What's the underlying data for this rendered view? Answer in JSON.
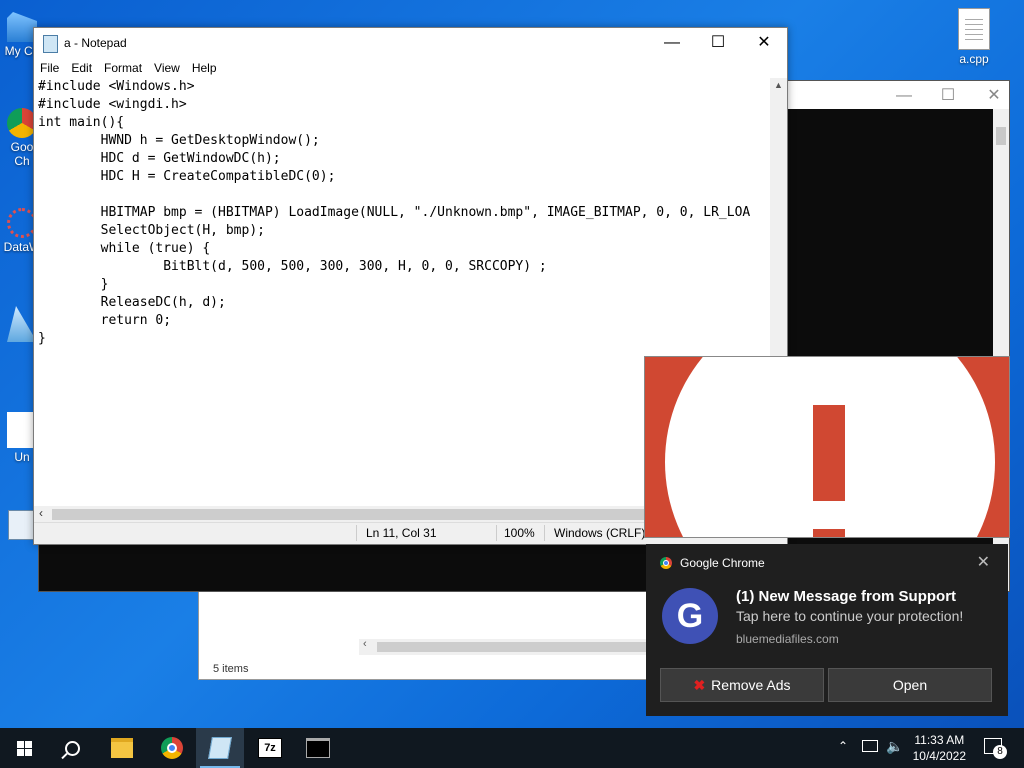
{
  "desktop": {
    "icons": [
      {
        "label": "My Co",
        "icon": "computer-icon"
      },
      {
        "label": "Goo Ch",
        "icon": "chrome-shortcut-icon"
      },
      {
        "label": "DataW",
        "icon": "dataw-shortcut-icon"
      },
      {
        "label": "",
        "icon": "recycle-icon"
      },
      {
        "label": "Un",
        "icon": "file-icon"
      }
    ],
    "file_icon": {
      "label": "a.cpp",
      "icon": "document-icon"
    }
  },
  "notepad": {
    "title": "a - Notepad",
    "menu": [
      "File",
      "Edit",
      "Format",
      "View",
      "Help"
    ],
    "code_lines": [
      "#include <Windows.h>",
      "#include <wingdi.h>",
      "int main(){",
      "        HWND h = GetDesktopWindow();",
      "        HDC d = GetWindowDC(h);",
      "        HDC H = CreateCompatibleDC(0);",
      "",
      "        HBITMAP bmp = (HBITMAP) LoadImage(NULL, \"./Unknown.bmp\", IMAGE_BITMAP, 0, 0, LR_LOA",
      "        SelectObject(H, bmp);",
      "        while (true) {",
      "                BitBlt(d, 500, 500, 300, 300, H, 0, 0, SRCCOPY) ;",
      "        }",
      "        ReleaseDC(h, d);",
      "        return 0;",
      "}"
    ],
    "status": {
      "position": "Ln 11, Col 31",
      "zoom": "100%",
      "line_endings": "Windows (CRLF)"
    }
  },
  "explorer": {
    "status": "5 items"
  },
  "notification": {
    "app": "Google Chrome",
    "avatar_letter": "G",
    "title": "(1) New Message from Support",
    "body": "Tap here to continue your protection!",
    "source": "bluemediafiles.com",
    "buttons": {
      "remove_ads": "Remove Ads",
      "open": "Open"
    }
  },
  "taskbar": {
    "apps": [
      "start-icon",
      "search-icon",
      "file-explorer-icon",
      "chrome-icon",
      "notepad-icon",
      "7zip-icon",
      "terminal-icon"
    ],
    "time": "11:33 AM",
    "date": "10/4/2022",
    "notification_count": "8"
  }
}
